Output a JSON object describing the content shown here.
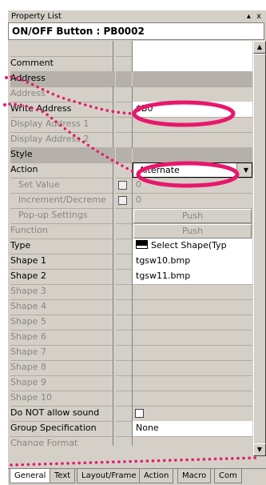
{
  "window": {
    "title": "Property List",
    "controls": "▴ x"
  },
  "object": {
    "header": "ON/OFF Button : PB0002"
  },
  "rows": {
    "comment": {
      "label": "Comment",
      "value": ""
    },
    "address_cat": {
      "label": "Address"
    },
    "address": {
      "label": "Address"
    },
    "write_address": {
      "label": "Write Address",
      "value": "$B0"
    },
    "display_address_1": {
      "label": "Display Address 1"
    },
    "display_address_2": {
      "label": "Display Address 2"
    },
    "style_cat": {
      "label": "Style"
    },
    "action": {
      "label": "Action",
      "value": "Alternate"
    },
    "set_value": {
      "label": "Set Value",
      "value": "0"
    },
    "increment": {
      "label": "Increment/Decreme",
      "value": "0"
    },
    "popup": {
      "label": "Pop-up Settings",
      "value": "Push"
    },
    "function": {
      "label": "Function",
      "value": "Push"
    },
    "type": {
      "label": "Type",
      "value": "Select Shape(Typ"
    },
    "shape1": {
      "label": "Shape 1",
      "value": "tgsw10.bmp"
    },
    "shape2": {
      "label": "Shape 2",
      "value": "tgsw11.bmp"
    },
    "shape3": {
      "label": "Shape 3"
    },
    "shape4": {
      "label": "Shape 4"
    },
    "shape5": {
      "label": "Shape 5"
    },
    "shape6": {
      "label": "Shape 6"
    },
    "shape7": {
      "label": "Shape 7"
    },
    "shape8": {
      "label": "Shape 8"
    },
    "shape9": {
      "label": "Shape 9"
    },
    "shape10": {
      "label": "Shape 10"
    },
    "no_sound": {
      "label": "Do NOT allow sound"
    },
    "group_spec": {
      "label": "Group Specification",
      "value": "None"
    },
    "last_partial": {
      "label": "Change Format"
    }
  },
  "tabs": [
    "General",
    "Text",
    "Layout/Frame",
    "Action",
    "Macro",
    "Com"
  ],
  "colors": {
    "annotation": "#e8176b",
    "category_bg": "#b5b1aa",
    "panel_bg": "#d4d0c8"
  }
}
